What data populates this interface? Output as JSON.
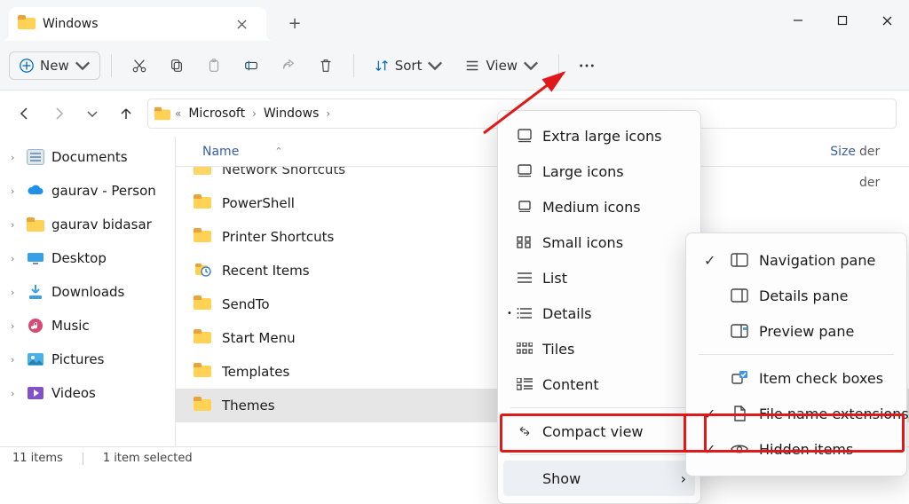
{
  "window": {
    "tab_title": "Windows"
  },
  "toolbar": {
    "new_label": "New",
    "sort_label": "Sort",
    "view_label": "View"
  },
  "breadcrumb": {
    "parent": "Microsoft",
    "current": "Windows"
  },
  "columns": {
    "name": "Name",
    "size": "Size"
  },
  "sidebar": {
    "items": [
      {
        "label": "Documents",
        "icon": "doc"
      },
      {
        "label": "gaurav - Person",
        "icon": "onedrive"
      },
      {
        "label": "gaurav bidasar",
        "icon": "folder"
      },
      {
        "label": "Desktop",
        "icon": "desktop"
      },
      {
        "label": "Downloads",
        "icon": "download"
      },
      {
        "label": "Music",
        "icon": "music"
      },
      {
        "label": "Pictures",
        "icon": "pictures"
      },
      {
        "label": "Videos",
        "icon": "videos"
      }
    ]
  },
  "folders": [
    {
      "label": "Network Shortcuts",
      "icon": "folder",
      "cut": true
    },
    {
      "label": "PowerShell",
      "icon": "folder"
    },
    {
      "label": "Printer Shortcuts",
      "icon": "folder"
    },
    {
      "label": "Recent Items",
      "icon": "recent"
    },
    {
      "label": "SendTo",
      "icon": "folder"
    },
    {
      "label": "Start Menu",
      "icon": "folder"
    },
    {
      "label": "Templates",
      "icon": "folder"
    },
    {
      "label": "Themes",
      "icon": "folder",
      "selected": true
    }
  ],
  "view_menu": [
    {
      "label": "Extra large icons",
      "icon": "xl"
    },
    {
      "label": "Large icons",
      "icon": "lg"
    },
    {
      "label": "Medium icons",
      "icon": "md"
    },
    {
      "label": "Small icons",
      "icon": "sm"
    },
    {
      "label": "List",
      "icon": "list"
    },
    {
      "label": "Details",
      "icon": "details",
      "active": true
    },
    {
      "label": "Tiles",
      "icon": "tiles"
    },
    {
      "label": "Content",
      "icon": "content"
    },
    {
      "sep": true
    },
    {
      "label": "Compact view",
      "icon": "compact"
    },
    {
      "sep": true
    },
    {
      "label": "Show",
      "icon": "",
      "hovered": true,
      "submenu": true,
      "highlighted": true
    }
  ],
  "show_menu": [
    {
      "label": "Navigation pane",
      "icon": "navpane",
      "checked": true
    },
    {
      "label": "Details pane",
      "icon": "detpane",
      "checked": false
    },
    {
      "label": "Preview pane",
      "icon": "prevpane",
      "checked": false
    },
    {
      "sep": true
    },
    {
      "label": "Item check boxes",
      "icon": "checkboxes",
      "checked": false
    },
    {
      "label": "File name extensions",
      "icon": "ext",
      "checked": true
    },
    {
      "label": "Hidden items",
      "icon": "hidden",
      "checked": true,
      "highlighted": true
    }
  ],
  "status": {
    "count_label": "11 items",
    "selected_label": "1 item selected"
  },
  "visible_text": {
    "der_suffix": "der"
  }
}
